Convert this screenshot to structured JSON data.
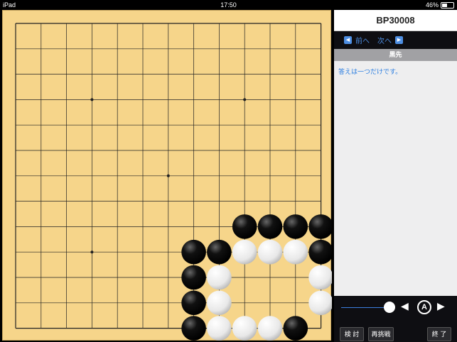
{
  "status": {
    "device": "iPad",
    "time": "17:50",
    "battery": "46%"
  },
  "panel": {
    "title": "BP30008",
    "prev_label": "前へ",
    "next_label": "次へ",
    "turn": "黒先",
    "hint": "答えは一つだけです。"
  },
  "controls": {
    "review": "検 討",
    "retry": "再挑戦",
    "end": "終 了",
    "a_label": "A"
  },
  "board": {
    "size": 13,
    "stones": [
      {
        "c": 9,
        "r": 8,
        "color": "black"
      },
      {
        "c": 10,
        "r": 8,
        "color": "black"
      },
      {
        "c": 11,
        "r": 8,
        "color": "black"
      },
      {
        "c": 12,
        "r": 8,
        "color": "black"
      },
      {
        "c": 7,
        "r": 9,
        "color": "black"
      },
      {
        "c": 8,
        "r": 9,
        "color": "black"
      },
      {
        "c": 9,
        "r": 9,
        "color": "white"
      },
      {
        "c": 10,
        "r": 9,
        "color": "white"
      },
      {
        "c": 11,
        "r": 9,
        "color": "white"
      },
      {
        "c": 12,
        "r": 9,
        "color": "black"
      },
      {
        "c": 7,
        "r": 10,
        "color": "black"
      },
      {
        "c": 8,
        "r": 10,
        "color": "white"
      },
      {
        "c": 12,
        "r": 10,
        "color": "white"
      },
      {
        "c": 7,
        "r": 11,
        "color": "black"
      },
      {
        "c": 8,
        "r": 11,
        "color": "white"
      },
      {
        "c": 12,
        "r": 11,
        "color": "white"
      },
      {
        "c": 7,
        "r": 12,
        "color": "black"
      },
      {
        "c": 8,
        "r": 12,
        "color": "white"
      },
      {
        "c": 9,
        "r": 12,
        "color": "white"
      },
      {
        "c": 10,
        "r": 12,
        "color": "white"
      },
      {
        "c": 11,
        "r": 12,
        "color": "black"
      }
    ],
    "star_points": [
      [
        3,
        3
      ],
      [
        9,
        3
      ],
      [
        6,
        6
      ],
      [
        3,
        9
      ],
      [
        9,
        9
      ]
    ]
  }
}
